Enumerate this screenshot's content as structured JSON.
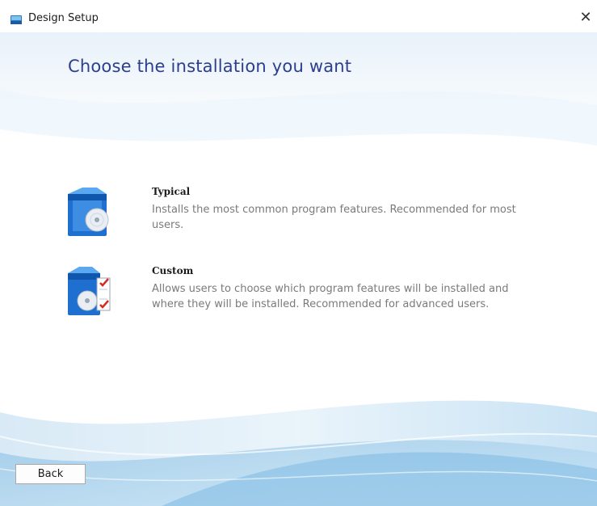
{
  "window": {
    "title": "Design Setup",
    "close_glyph": "✕"
  },
  "heading": "Choose the installation you want",
  "options": [
    {
      "title": "Typical",
      "description": "Installs the most common program features. Recommended for most users.",
      "icon": "box-cd-icon"
    },
    {
      "title": "Custom",
      "description": "Allows users to choose which program features will be installed and where they will be installed. Recommended for advanced users.",
      "icon": "box-cd-checklist-icon"
    }
  ],
  "footer": {
    "back_label": "Back"
  },
  "colors": {
    "heading": "#2c3e8f",
    "accent_blue": "#1f6fd0",
    "check_red": "#d42a20"
  }
}
